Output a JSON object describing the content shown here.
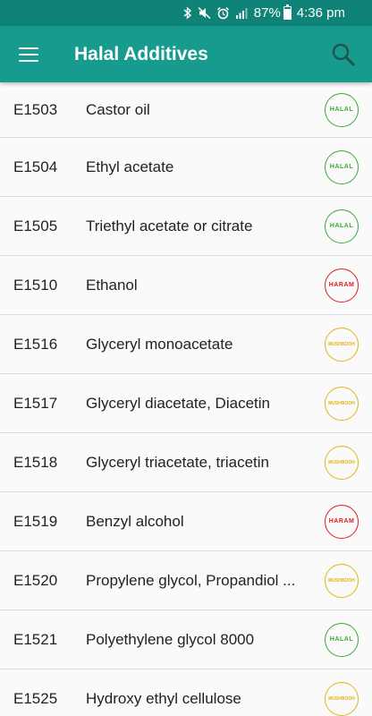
{
  "status_bar": {
    "battery_percent": "87%",
    "time": "4:36 pm",
    "icons": [
      "bluetooth-icon",
      "mute-icon",
      "alarm-icon",
      "signal-icon",
      "battery-icon"
    ]
  },
  "app_bar": {
    "title": "Halal Additives",
    "menu_icon": "menu-icon",
    "search_icon": "search-icon"
  },
  "colors": {
    "status_bar": "#0f8378",
    "app_bar": "#179b8e",
    "halal": "#3aab3a",
    "haram": "#d81f1f",
    "mushbooh": "#e3b416"
  },
  "additives": [
    {
      "code": "E1503",
      "name": "Castor oil",
      "status": "halal",
      "badge": "HALAL"
    },
    {
      "code": "E1504",
      "name": "Ethyl acetate",
      "status": "halal",
      "badge": "HALAL"
    },
    {
      "code": "E1505",
      "name": "Triethyl acetate or citrate",
      "status": "halal",
      "badge": "HALAL"
    },
    {
      "code": "E1510",
      "name": "Ethanol",
      "status": "haram",
      "badge": "HARAM"
    },
    {
      "code": "E1516",
      "name": "Glyceryl monoacetate",
      "status": "mushbooh",
      "badge": "MUSHBOOH"
    },
    {
      "code": "E1517",
      "name": "Glyceryl diacetate, Diacetin",
      "status": "mushbooh",
      "badge": "MUSHBOOH"
    },
    {
      "code": "E1518",
      "name": "Glyceryl triacetate, triacetin",
      "status": "mushbooh",
      "badge": "MUSHBOOH"
    },
    {
      "code": "E1519",
      "name": "Benzyl alcohol",
      "status": "haram",
      "badge": "HARAM"
    },
    {
      "code": "E1520",
      "name": "Propylene glycol, Propandiol ...",
      "status": "mushbooh",
      "badge": "MUSHBOOH"
    },
    {
      "code": "E1521",
      "name": "Polyethylene glycol 8000",
      "status": "halal",
      "badge": "HALAL"
    },
    {
      "code": "E1525",
      "name": "Hydroxy ethyl cellulose",
      "status": "mushbooh",
      "badge": "MUSHBOOH"
    }
  ]
}
